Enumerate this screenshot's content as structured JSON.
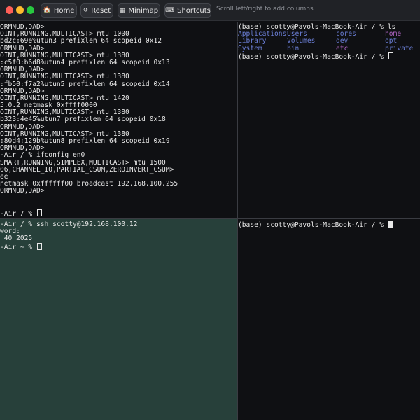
{
  "toolbar": {
    "home_label": "Home",
    "reset_label": "Reset",
    "minimap_label": "Minimap",
    "shortcuts_label": "Shortcuts",
    "hint": "Scroll left/right to add columns"
  },
  "panes": {
    "top_left": {
      "lines": [
        "ORMNUD,DAD>",
        "OINT,RUNNING,MULTICAST> mtu 1000",
        "bd2c:69e%utun3 prefixlen 64 scopeid 0x12",
        "ORMNUD,DAD>",
        "OINT,RUNNING,MULTICAST> mtu 1380",
        ":c5f0:b6d8%utun4 prefixlen 64 scopeid 0x13",
        "ORMNUD,DAD>",
        "OINT,RUNNING,MULTICAST> mtu 1380",
        ":fb50:f7a2%utun5 prefixlen 64 scopeid 0x14",
        "ORMNUD,DAD>",
        "OINT,RUNNING,MULTICAST> mtu 1420",
        "5.0.2 netmask 0xffff0000",
        "OINT,RUNNING,MULTICAST> mtu 1380",
        "b323:4e45%utun7 prefixlen 64 scopeid 0x18",
        "ORMNUD,DAD>",
        "OINT,RUNNING,MULTICAST> mtu 1380",
        ":80d4:129b%utun8 prefixlen 64 scopeid 0x19",
        "ORMNUD,DAD>",
        "-Air / % ifconfig en0",
        "SMART,RUNNING,SIMPLEX,MULTICAST> mtu 1500",
        "06,CHANNEL_IO,PARTIAL_CSUM,ZEROINVERT_CSUM>",
        "ee",
        "netmask 0xffffff00 broadcast 192.168.100.255",
        "ORMNUD,DAD>",
        "",
        "",
        "-Air / % "
      ]
    },
    "bottom_left": {
      "lines": [
        "-Air / % ssh scotty@192.168.100.12",
        "word:",
        " 40 2025",
        "-Air ~ % "
      ]
    },
    "top_right": {
      "prompt1": "(base) scotty@Pavols-MacBook-Air / % ls",
      "ls_items": [
        {
          "name": "Applications",
          "color": "dir"
        },
        {
          "name": "Users",
          "color": "dir"
        },
        {
          "name": "cores",
          "color": "dir"
        },
        {
          "name": "home",
          "color": "purple"
        },
        {
          "name": "Library",
          "color": "dir"
        },
        {
          "name": "Volumes",
          "color": "dir"
        },
        {
          "name": "dev",
          "color": "dir"
        },
        {
          "name": "opt",
          "color": "dir"
        },
        {
          "name": "System",
          "color": "dir"
        },
        {
          "name": "bin",
          "color": "dir"
        },
        {
          "name": "etc",
          "color": "purple"
        },
        {
          "name": "private",
          "color": "dir"
        }
      ],
      "prompt2": "(base) scotty@Pavols-MacBook-Air / % "
    },
    "bottom_right": {
      "prompt": "(base) scotty@Pavols-MacBook-Air / % "
    }
  },
  "colors": {
    "dir": "#6b7fd7",
    "purple": "#b267c7",
    "active_pane_bg": "#27403a"
  }
}
